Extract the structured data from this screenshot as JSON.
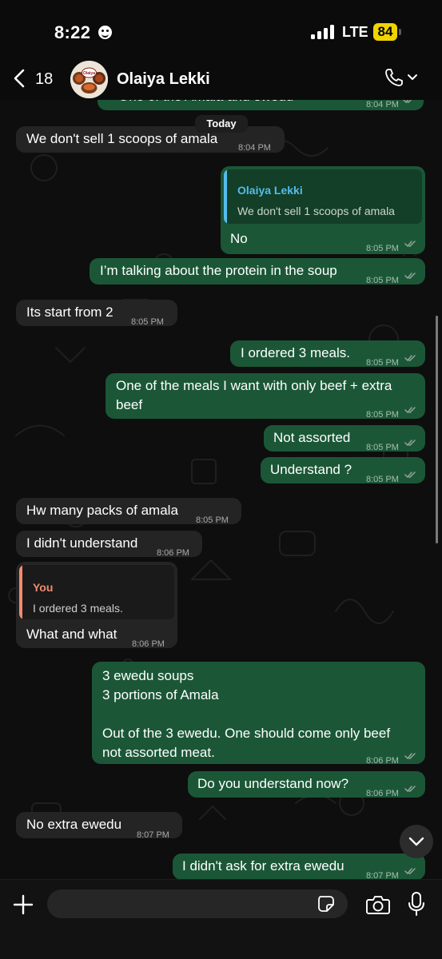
{
  "status_bar": {
    "time": "8:22",
    "network": "LTE",
    "battery": "84"
  },
  "header": {
    "back_count": "18",
    "contact_name": "Olaiya Lekki",
    "avatar_text": "Olaiya"
  },
  "date_chip": "Today",
  "messages": [
    {
      "dir": "out",
      "text": "One of the Amala and ewedu",
      "time": "8:04 PM"
    },
    {
      "dir": "in",
      "text": "We don't sell 1 scoops of amala",
      "time": "8:04 PM"
    },
    {
      "dir": "out",
      "quote_author": "Olaiya Lekki",
      "quote_text": "We don't sell 1 scoops of amala",
      "text": "No",
      "time": "8:05 PM"
    },
    {
      "dir": "out",
      "text": "I’m talking about the protein in the soup",
      "time": "8:05 PM"
    },
    {
      "dir": "in",
      "text": "Its start from 2",
      "time": "8:05 PM"
    },
    {
      "dir": "out",
      "text": "I ordered 3 meals.",
      "time": "8:05 PM"
    },
    {
      "dir": "out",
      "text": "One of the meals I want with only beef + extra\nbeef",
      "time": "8:05 PM"
    },
    {
      "dir": "out",
      "text": "Not assorted",
      "time": "8:05 PM"
    },
    {
      "dir": "out",
      "text": "Understand ?",
      "time": "8:05 PM"
    },
    {
      "dir": "in",
      "text": "Hw many packs of amala",
      "time": "8:05 PM"
    },
    {
      "dir": "in",
      "text": "I didn't understand",
      "time": "8:06 PM"
    },
    {
      "dir": "in",
      "quote_author": "You",
      "quote_text": "I ordered 3 meals.",
      "text": "What and what",
      "time": "8:06 PM"
    },
    {
      "dir": "out",
      "text": "3 ewedu soups\n3 portions of Amala\n\nOut of the 3 ewedu. One should come only beef\nnot assorted meat.",
      "time": "8:06 PM"
    },
    {
      "dir": "out",
      "text": "Do you understand now?",
      "time": "8:06 PM"
    },
    {
      "dir": "in",
      "text": "No extra ewedu",
      "time": "8:07 PM"
    },
    {
      "dir": "out",
      "text": "I didn't ask for extra ewedu",
      "time": "8:07 PM"
    }
  ],
  "input": {
    "placeholder": ""
  },
  "colors": {
    "incoming": "#242424",
    "outgoing": "#1b5737",
    "quote_contact": "#53bdeb",
    "quote_you": "#f28b6e",
    "read_ticks": "#9aa7a0"
  }
}
